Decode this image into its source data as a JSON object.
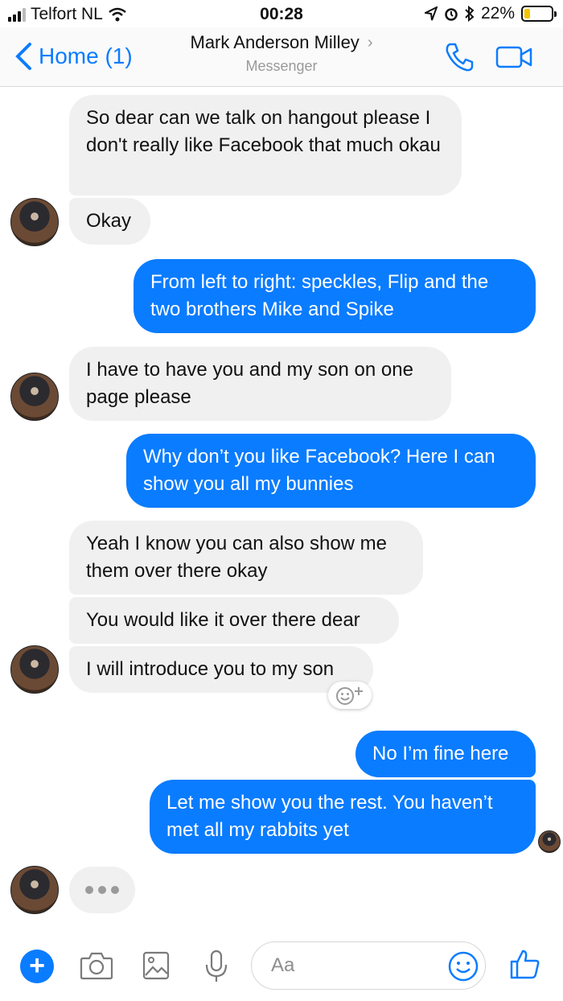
{
  "status_bar": {
    "carrier": "Telfort NL",
    "time": "00:28",
    "battery": "22%"
  },
  "header": {
    "back_label": "Home (1)",
    "contact_name": "Mark Anderson Milley",
    "subtitle": "Messenger",
    "accent_color": "#0a7cff"
  },
  "messages": [
    {
      "from": "contact",
      "text": "So dear can we talk on hangout please I don't really like Facebook that much okau"
    },
    {
      "from": "contact",
      "text": "Okay"
    },
    {
      "from": "me",
      "text": "From left to right: speckles, Flip and the two brothers Mike and Spike"
    },
    {
      "from": "contact",
      "text": "I have to have you and my son on one page please"
    },
    {
      "from": "me",
      "text": "Why don’t you like Facebook? Here I can show you all my bunnies"
    },
    {
      "from": "contact",
      "text": "Yeah I know you can also show me them over there okay"
    },
    {
      "from": "contact",
      "text": "You would like it over there dear"
    },
    {
      "from": "contact",
      "text": "I will introduce you to my son"
    },
    {
      "from": "me",
      "text": "No I’m fine here"
    },
    {
      "from": "me",
      "text": "Let me show you the rest. You haven’t met all my rabbits yet"
    }
  ],
  "composer": {
    "placeholder": "Aa",
    "icons": [
      "plus-icon",
      "camera-icon",
      "gallery-icon",
      "microphone-icon",
      "emoji-icon",
      "thumbs-up-icon"
    ]
  }
}
